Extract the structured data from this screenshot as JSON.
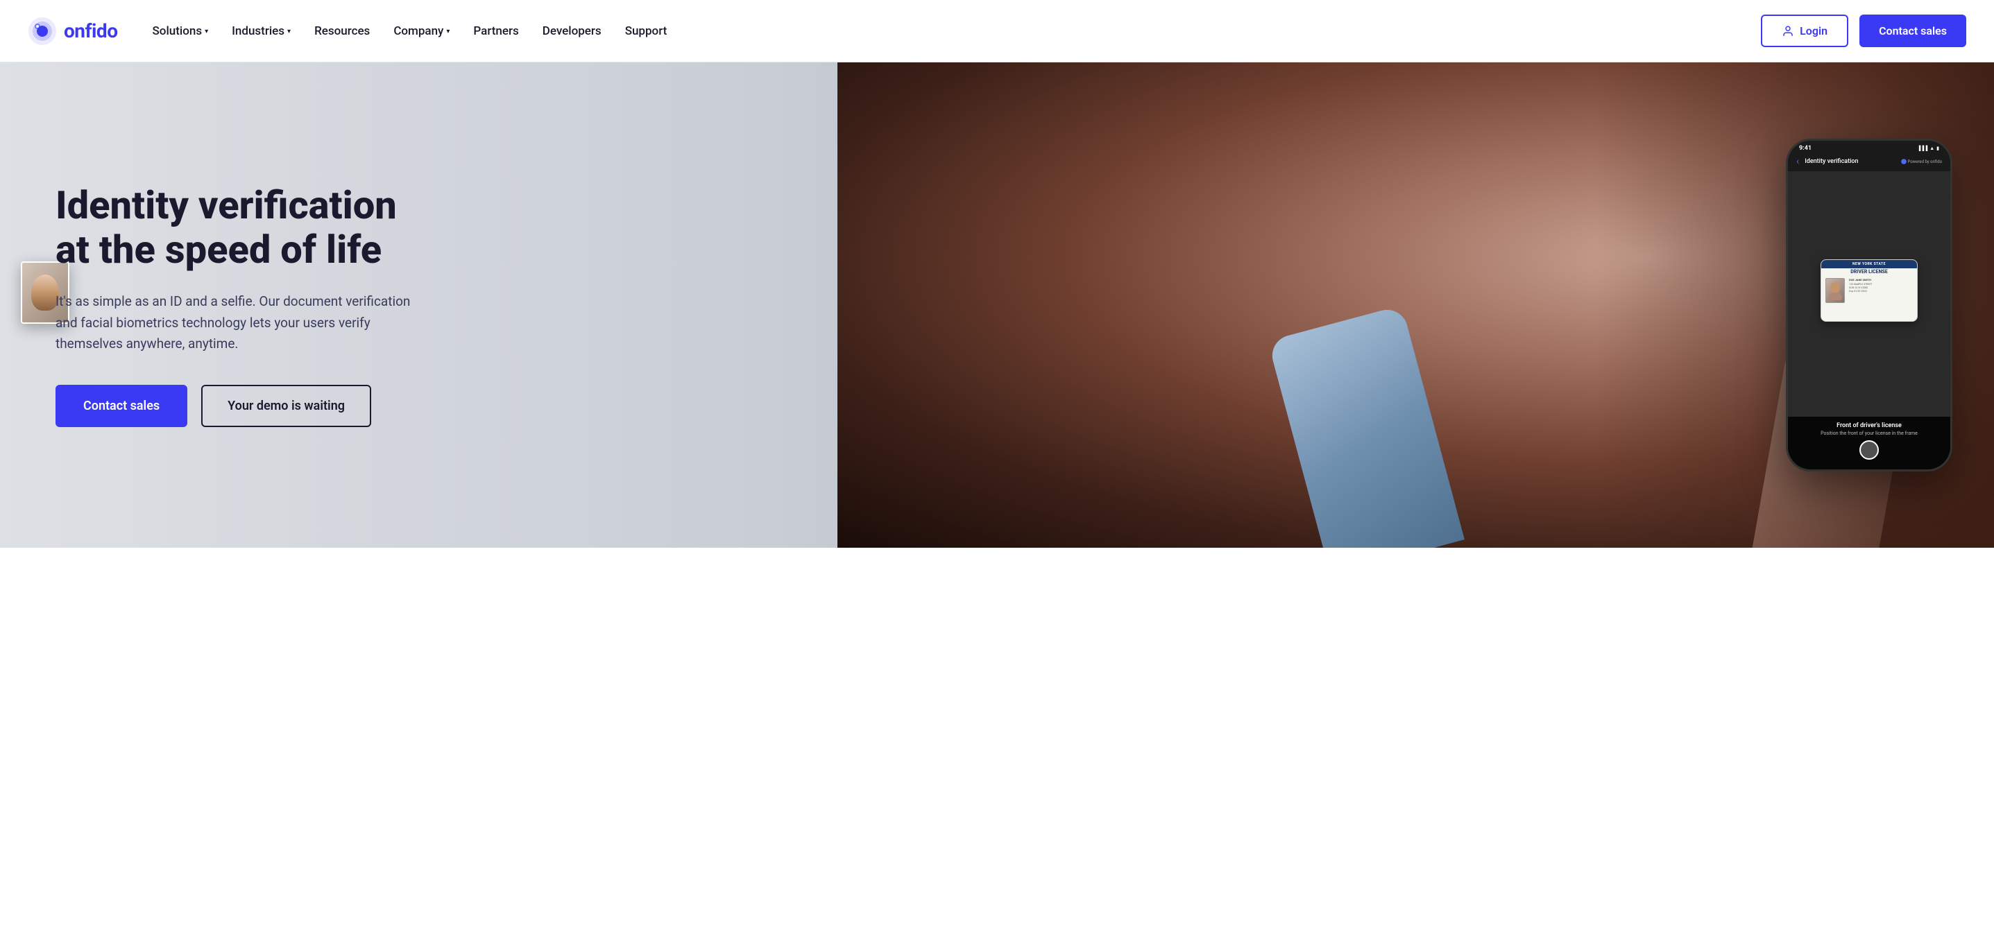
{
  "logo": {
    "text": "onfido",
    "alt": "Onfido logo"
  },
  "nav": {
    "links": [
      {
        "label": "Solutions",
        "hasDropdown": true,
        "id": "solutions"
      },
      {
        "label": "Industries",
        "hasDropdown": true,
        "id": "industries"
      },
      {
        "label": "Resources",
        "hasDropdown": false,
        "id": "resources"
      },
      {
        "label": "Company",
        "hasDropdown": true,
        "id": "company"
      },
      {
        "label": "Partners",
        "hasDropdown": false,
        "id": "partners"
      },
      {
        "label": "Developers",
        "hasDropdown": false,
        "id": "developers"
      },
      {
        "label": "Support",
        "hasDropdown": false,
        "id": "support"
      }
    ],
    "login_label": "Login",
    "contact_sales_label": "Contact sales"
  },
  "hero": {
    "title_line1": "Identity verification",
    "title_line2": "at the speed of life",
    "description": "It's as simple as an ID and a selfie. Our document verification and facial biometrics technology lets your users verify themselves anywhere, anytime.",
    "btn_contact": "Contact sales",
    "btn_demo": "Your demo is waiting"
  },
  "phone": {
    "time": "9:41",
    "header_title": "Identity verification",
    "back_label": "‹",
    "powered_by": "Powered by onfido",
    "id_card": {
      "state_header": "NEW YORK STATE",
      "type": "DRIVER LICENSE",
      "name": "DOE\nJANE SMITH",
      "address": "123 SAMPLE STREET",
      "dob": "01/01/2000",
      "exp": "01/01/2022"
    },
    "bottom_label_title": "Front of driver's license",
    "bottom_label_sub": "Position the front of your license in the frame"
  },
  "colors": {
    "brand_blue": "#3a3af4",
    "nav_text": "#1a1a2e",
    "hero_title": "#1a1a2e",
    "hero_desc": "#3a3a5c",
    "white": "#ffffff"
  }
}
